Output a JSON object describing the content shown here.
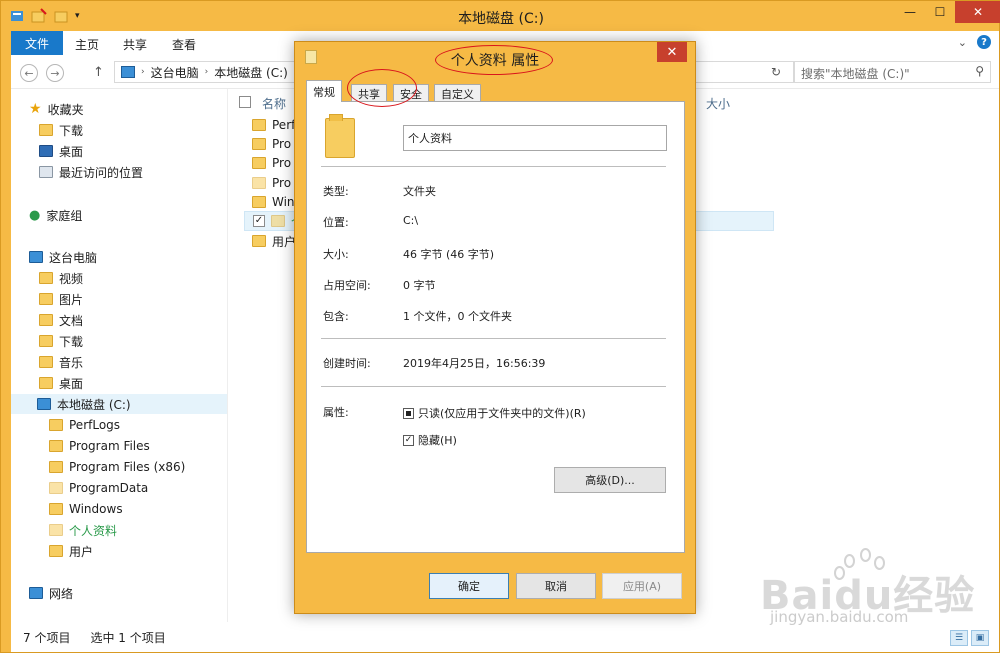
{
  "window": {
    "title": "本地磁盘 (C:)",
    "controls": {
      "minimize": "—",
      "maximize": "☐",
      "close": "✕"
    }
  },
  "ribbon": {
    "file_tab": "文件",
    "tabs": [
      "主页",
      "共享",
      "查看"
    ]
  },
  "address": {
    "crumbs": [
      "这台电脑",
      "本地磁盘 (C:)"
    ],
    "search_placeholder": "搜索\"本地磁盘 (C:)\""
  },
  "nav": {
    "favorites": "收藏夹",
    "favorites_items": [
      "下载",
      "桌面",
      "最近访问的位置"
    ],
    "homegroup": "家庭组",
    "thispc": "这台电脑",
    "pc_items": [
      "视频",
      "图片",
      "文档",
      "下载",
      "音乐",
      "桌面"
    ],
    "drive": "本地磁盘 (C:)",
    "drive_items": [
      "PerfLogs",
      "Program Files",
      "Program Files (x86)",
      "ProgramData",
      "Windows",
      "个人资料",
      "用户"
    ],
    "network": "网络"
  },
  "filelist": {
    "col_name": "名称",
    "col_size": "大小",
    "rows": [
      "Perf",
      "Pro",
      "Pro",
      "Pro",
      "Win",
      "个人",
      "用户"
    ]
  },
  "status": {
    "count": "7 个项目",
    "selected": "选中 1 个项目"
  },
  "dialog": {
    "title": "个人资料 属性",
    "tabs": [
      "常规",
      "共享",
      "安全",
      "自定义"
    ],
    "name_value": "个人资料",
    "props": [
      {
        "label": "类型:",
        "value": "文件夹"
      },
      {
        "label": "位置:",
        "value": "C:\\"
      },
      {
        "label": "大小:",
        "value": "46 字节 (46 字节)"
      },
      {
        "label": "占用空间:",
        "value": "0 字节"
      },
      {
        "label": "包含:",
        "value": "1 个文件，0 个文件夹"
      }
    ],
    "created_label": "创建时间:",
    "created_value": "2019年4月25日，16:56:39",
    "attr_label": "属性:",
    "readonly_label": "只读(仅应用于文件夹中的文件)(R)",
    "hidden_label": "隐藏(H)",
    "advanced_button": "高级(D)...",
    "ok": "确定",
    "cancel": "取消",
    "apply": "应用(A)"
  },
  "watermark": {
    "brand": "Baidu经验",
    "url": "jingyan.baidu.com"
  }
}
